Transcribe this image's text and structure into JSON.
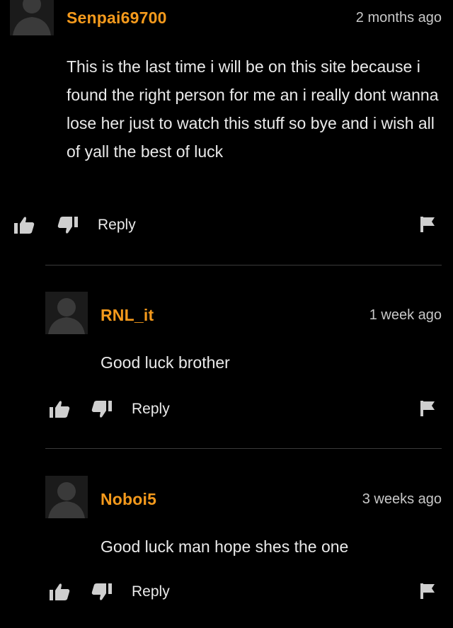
{
  "comments": [
    {
      "username": "Senpai69700",
      "time": "2 months ago",
      "text": "This is the last time i will be on this site because i found the right person for me an i really dont wanna lose her just to watch this stuff so bye and i wish all of yall the best of luck",
      "reply_label": "Reply"
    },
    {
      "username": "RNL_it",
      "time": "1 week ago",
      "text": "Good luck brother",
      "reply_label": "Reply"
    },
    {
      "username": "Noboi5",
      "time": "3 weeks ago",
      "text": "Good luck man hope shes the one",
      "reply_label": "Reply"
    }
  ],
  "icons": {
    "avatar": "default-avatar-icon",
    "like": "thumbs-up-icon",
    "dislike": "thumbs-down-icon",
    "flag": "flag-icon"
  },
  "colors": {
    "background": "#000000",
    "username": "#f59a1c",
    "text": "#eaeaea",
    "icon": "#cfcfcf"
  }
}
